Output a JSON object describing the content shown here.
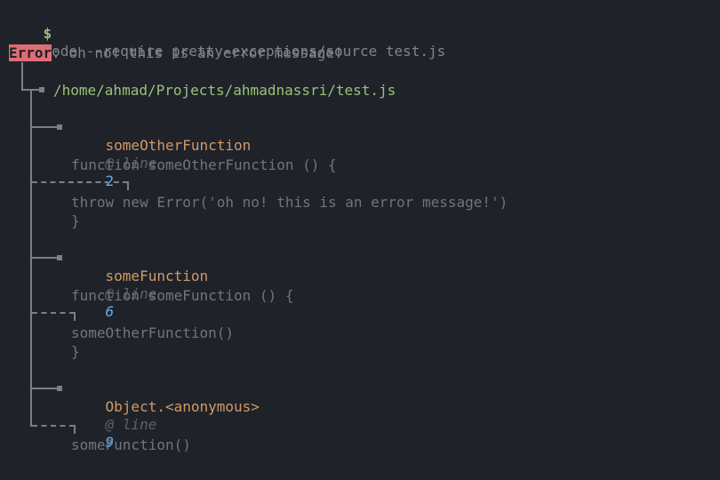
{
  "terminal": {
    "prompt": "$",
    "command": "node --require pretty-exceptions/source test.js"
  },
  "error": {
    "label": "Error",
    "separator": ":",
    "message": " oh no! this is an error message!"
  },
  "file": {
    "path": "/home/ahmad/Projects/ahmadnassri/test.js"
  },
  "frames": [
    {
      "function": "someOtherFunction",
      "at": "@ line",
      "line": "2",
      "code": [
        "function someOtherFunction () {",
        "throw new Error('oh no! this is an error message!')",
        "}"
      ]
    },
    {
      "function": "someFunction",
      "at": "@ line",
      "line": "6",
      "code": [
        "function someFunction () {",
        "someOtherFunction()",
        "}"
      ]
    },
    {
      "function": "Object.<anonymous>",
      "at": "@ line",
      "line": "9",
      "code": [
        "someFunction()"
      ]
    }
  ],
  "colors": {
    "background": "#1f2229",
    "prompt": "#98c379",
    "error_badge": "#e06c75",
    "path": "#98c379",
    "function": "#d19a66",
    "line_number": "#61afef",
    "muted": "#7f8590"
  }
}
